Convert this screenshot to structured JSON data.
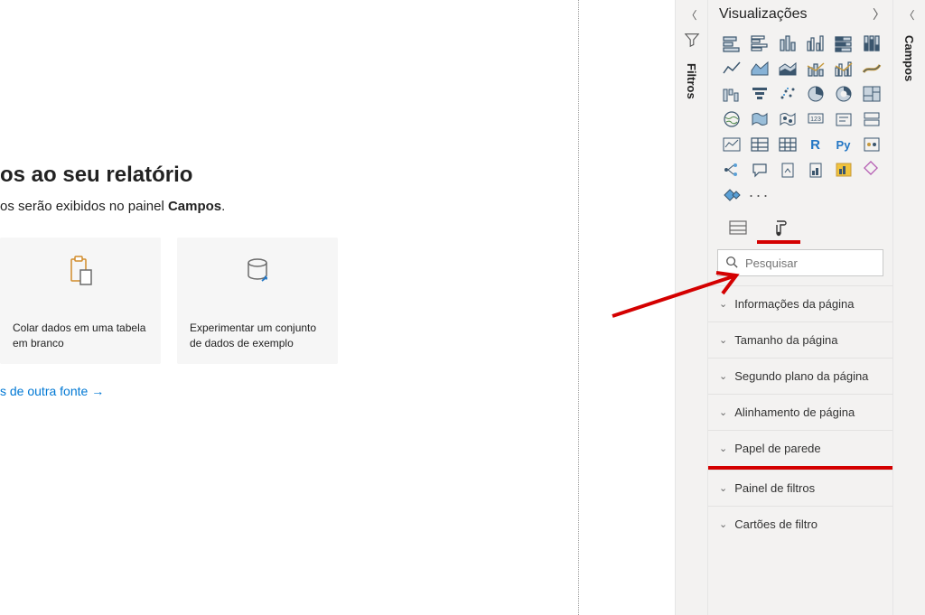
{
  "canvas": {
    "title_suffix": "os ao seu relatório",
    "subtitle_prefix": "os serão exibidos no painel ",
    "subtitle_bold": "Campos",
    "subtitle_suffix": ".",
    "cards": [
      {
        "label": "Colar dados em uma tabela em branco"
      },
      {
        "label": "Experimentar um conjunto de dados de exemplo"
      }
    ],
    "other_link": "s de outra fonte",
    "other_link_arrow": "→"
  },
  "filters": {
    "label": "Filtros"
  },
  "viz_panel": {
    "title": "Visualizações",
    "gallery": [
      "stacked-bar",
      "clustered-bar",
      "stacked-column",
      "clustered-column",
      "stacked100-bar",
      "stacked100-column",
      "line",
      "area",
      "stacked-area",
      "line-clustered",
      "line-stacked",
      "ribbon",
      "waterfall",
      "funnel",
      "scatter",
      "pie",
      "donut",
      "treemap",
      "map",
      "filled-map",
      "shape-map",
      "gauge",
      "card",
      "multi-row-card",
      "kpi",
      "slicer",
      "table",
      "r-visual",
      "py-visual",
      "key-influencers",
      "decomposition",
      "qa",
      "export",
      "paginated",
      "pbi-apps",
      "more-visual",
      "custom-visual"
    ],
    "r_label": "R",
    "py_label": "Py",
    "tabs": {
      "fields_tab": "fields",
      "format_tab": "format"
    },
    "search_placeholder": "Pesquisar",
    "sections": [
      "Informações da página",
      "Tamanho da página",
      "Segundo plano da página",
      "Alinhamento de página",
      "Papel de parede",
      "Painel de filtros",
      "Cartões de filtro"
    ]
  },
  "fields": {
    "label": "Campos"
  }
}
